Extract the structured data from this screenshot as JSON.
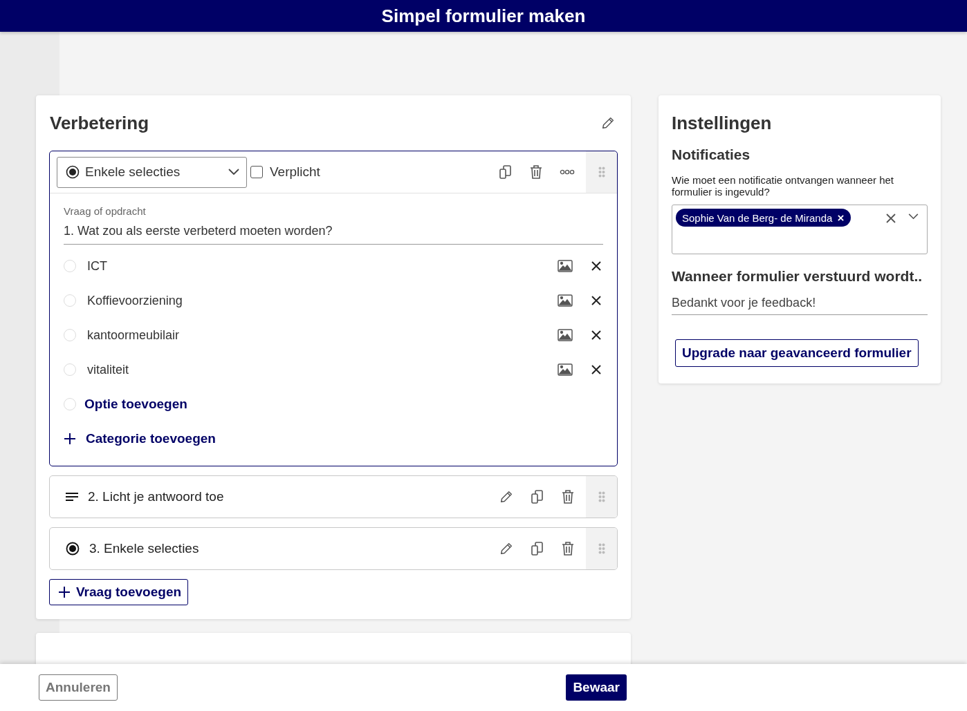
{
  "header": {
    "title": "Simpel formulier maken"
  },
  "form": {
    "title": "Verbetering",
    "questions": [
      {
        "kind": "single_choice",
        "expanded": true,
        "type_label": "Enkele selecties",
        "required_label": "Verplicht",
        "required": false,
        "field_label": "Vraag of opdracht",
        "question": "1. Wat zou als eerste verbeterd moeten worden?",
        "options": [
          {
            "label": "ICT",
            "selected": false
          },
          {
            "label": "Koffievoorziening",
            "selected": false
          },
          {
            "label": "kantoormeubilair",
            "selected": false
          },
          {
            "label": "vitaliteit",
            "selected": false
          }
        ],
        "add_option": "Optie toevoegen",
        "add_category": "Categorie toevoegen"
      },
      {
        "kind": "text",
        "expanded": false,
        "title": "2. Licht je antwoord toe"
      },
      {
        "kind": "single_choice",
        "expanded": false,
        "title": "3. Enkele selecties"
      }
    ],
    "add_question": "Vraag toevoegen"
  },
  "settings": {
    "title": "Instellingen",
    "notifications": {
      "heading": "Notificaties",
      "prompt": "Wie moet een notificatie ontvangen wanneer het formulier is ingevuld?",
      "recipients": [
        "Sophie Van de Berg- de Miranda"
      ]
    },
    "on_submit": {
      "heading": "Wanneer formulier verstuurd wordt..",
      "message": "Bedankt voor je feedback!"
    },
    "upgrade_button": "Upgrade naar geavanceerd formulier"
  },
  "footer": {
    "cancel": "Annuleren",
    "save": "Bewaar"
  }
}
